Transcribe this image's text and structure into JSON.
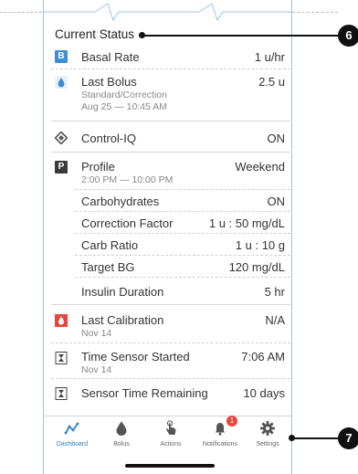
{
  "section_title": "Current Status",
  "rows": {
    "basal": {
      "icon_text": "B",
      "label": "Basal Rate",
      "value": "1 u/hr"
    },
    "last_bolus": {
      "label": "Last Bolus",
      "sub1": "Standard/Correction",
      "sub2": "Aug 25 — 10:45 AM",
      "value": "2.5 u"
    },
    "control_iq": {
      "label": "Control-IQ",
      "value": "ON"
    },
    "profile": {
      "icon_text": "P",
      "label": "Profile",
      "sub": "2:00 PM — 10:00 PM",
      "value": "Weekend"
    },
    "carbohydrates": {
      "label": "Carbohydrates",
      "value": "ON"
    },
    "correction_factor": {
      "label": "Correction Factor",
      "value": "1 u : 50 mg/dL"
    },
    "carb_ratio": {
      "label": "Carb Ratio",
      "value": "1 u : 10 g"
    },
    "target_bg": {
      "label": "Target BG",
      "value": "120 mg/dL"
    },
    "insulin_duration": {
      "label": "Insulin Duration",
      "value": "5 hr"
    },
    "last_calibration": {
      "label": "Last Calibration",
      "sub": "Nov 14",
      "value": "N/A"
    },
    "time_sensor_started": {
      "label": "Time Sensor Started",
      "sub": "Nov 14",
      "value": "7:06 AM"
    },
    "sensor_time_remaining": {
      "label": "Sensor Time Remaining",
      "value": "10 days"
    }
  },
  "nav": {
    "dashboard": "Dashboard",
    "bolus": "Bolus",
    "actions": "Actions",
    "notifications": "Notifications",
    "notifications_badge": "1",
    "settings": "Settings"
  },
  "callouts": {
    "status": "6",
    "nav": "7"
  },
  "icons": {
    "basal": "basal-b-icon",
    "bolus": "insulin-drop-icon",
    "control_iq": "control-iq-diamond-icon",
    "profile": "profile-p-icon",
    "calibration": "blood-drop-icon",
    "sensor": "hourglass-icon",
    "nav_dashboard": "trend-chart-icon",
    "nav_bolus": "drop-icon",
    "nav_actions": "hand-tap-icon",
    "nav_notifications": "bell-icon",
    "nav_settings": "gear-icon"
  },
  "colors": {
    "accent_blue": "#3f8fd2",
    "alert_red": "#e5483b",
    "nav_active": "#2f7fc1"
  }
}
